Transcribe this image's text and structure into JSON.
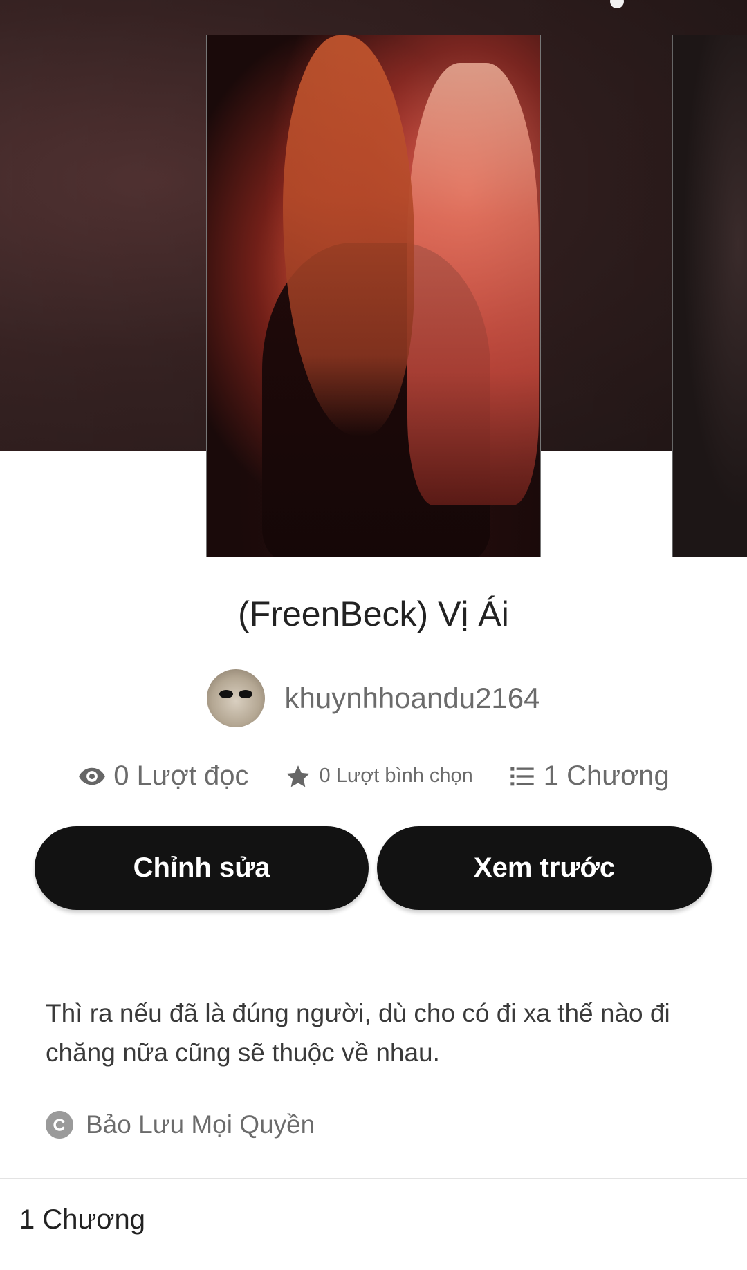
{
  "story": {
    "title": "(FreenBeck) Vị Ái",
    "author": "khuynhhoandu2164",
    "description": "Thì ra nếu đã là đúng người, dù cho có đi xa thế nào đi chăng nữa cũng sẽ thuộc về nhau.",
    "copyright": "Bảo Lưu Mọi Quyền"
  },
  "stats": {
    "reads": "0 Lượt đọc",
    "votes": "0 Lượt bình chọn",
    "parts": "1 Chương"
  },
  "buttons": {
    "edit": "Chỉnh sửa",
    "preview": "Xem trước"
  },
  "parts_section": {
    "heading": "1 Chương"
  },
  "icons": {
    "reads": "eye-icon",
    "votes": "star-icon",
    "parts": "list-icon",
    "copyright": "copyright-icon"
  },
  "colors": {
    "button_bg": "#121212",
    "button_text": "#ffffff",
    "muted_text": "#6b6b6b",
    "header_bg": "#3d2525"
  }
}
